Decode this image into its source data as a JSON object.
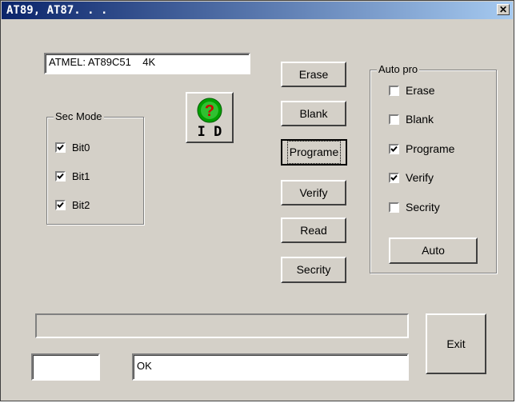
{
  "window": {
    "title": "AT89, AT87. . .",
    "close_glyph": "✕"
  },
  "device_field": {
    "value": "ATMEL: AT89C51    4K"
  },
  "sec_mode": {
    "legend": "Sec Mode",
    "items": [
      {
        "label": "Bit0",
        "checked": true
      },
      {
        "label": "Bit1",
        "checked": true
      },
      {
        "label": "Bit2",
        "checked": true
      }
    ]
  },
  "id_button": {
    "label": "I D",
    "icon": "question-mark-icon"
  },
  "actions": {
    "erase": "Erase",
    "blank": "Blank",
    "programe": "Programe",
    "verify": "Verify",
    "read": "Read",
    "secrity": "Secrity"
  },
  "auto_pro": {
    "legend": "Auto pro",
    "items": [
      {
        "label": "Erase",
        "checked": false
      },
      {
        "label": "Blank",
        "checked": false
      },
      {
        "label": "Programe",
        "checked": true
      },
      {
        "label": "Verify",
        "checked": true
      },
      {
        "label": "Secrity",
        "checked": false
      }
    ],
    "auto_label": "Auto"
  },
  "progress": {
    "value": 0
  },
  "exit_label": "Exit",
  "status": {
    "small_field": "",
    "message": "OK"
  }
}
